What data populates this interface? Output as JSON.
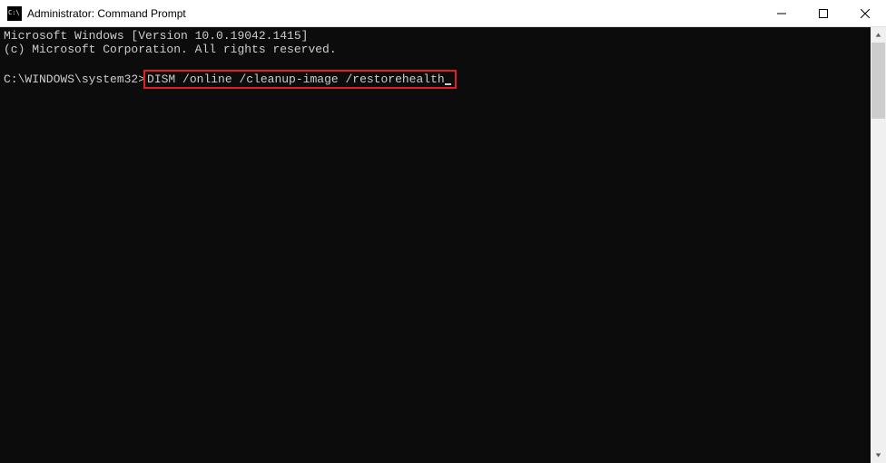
{
  "titlebar": {
    "title": "Administrator: Command Prompt"
  },
  "terminal": {
    "line1": "Microsoft Windows [Version 10.0.19042.1415]",
    "line2": "(c) Microsoft Corporation. All rights reserved.",
    "prompt": "C:\\WINDOWS\\system32>",
    "command": "DISM /online /cleanup-image /restorehealth"
  }
}
